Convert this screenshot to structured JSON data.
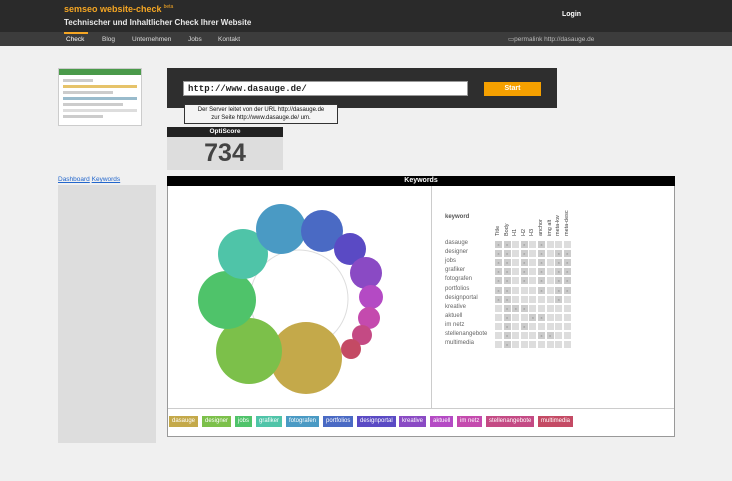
{
  "header": {
    "brand": "semseo website-check",
    "brand_sup": "beta",
    "tagline": "Technischer und Inhaltlicher Check Ihrer Website",
    "login": "Login"
  },
  "nav": {
    "items": [
      "Check",
      "Blog",
      "Unternehmen",
      "Jobs",
      "Kontakt"
    ],
    "permalink": "permalink http://dasauge.de"
  },
  "check": {
    "url_value": "http://www.dasauge.de/",
    "start_label": "Start",
    "tooltip_line1": "Der Server leitet von der URL http://dasauge.de",
    "tooltip_line2": "zur Seite http://www.dasauge.de/ um."
  },
  "score": {
    "label": "OptiScore",
    "value": "734"
  },
  "sidebar": {
    "links": [
      "Dashboard",
      "Keywords"
    ]
  },
  "keywords": {
    "title": "Keywords",
    "col_label": "keyword",
    "columns": [
      "Title",
      "Body",
      "H1",
      "H2",
      "H3",
      "anchor",
      "img alt",
      "meta-kw",
      "meta-desc"
    ],
    "rows": [
      {
        "name": "dasauge",
        "cells": [
          "x",
          "x",
          "",
          "x",
          "",
          "x",
          "",
          "",
          ""
        ]
      },
      {
        "name": "designer",
        "cells": [
          "x",
          "x",
          "",
          "x",
          "",
          "x",
          "",
          "x",
          "x"
        ]
      },
      {
        "name": "jobs",
        "cells": [
          "x",
          "x",
          "",
          "x",
          "",
          "x",
          "",
          "x",
          "x"
        ]
      },
      {
        "name": "grafiker",
        "cells": [
          "x",
          "x",
          "",
          "x",
          "",
          "x",
          "",
          "x",
          "x"
        ]
      },
      {
        "name": "fotografen",
        "cells": [
          "x",
          "x",
          "",
          "x",
          "",
          "x",
          "",
          "x",
          "x"
        ]
      },
      {
        "name": "portfolios",
        "cells": [
          "x",
          "x",
          "",
          "",
          "",
          "x",
          "",
          "x",
          "x"
        ]
      },
      {
        "name": "designportal",
        "cells": [
          "x",
          "x",
          "",
          "",
          "",
          "",
          "",
          "x",
          ""
        ]
      },
      {
        "name": "kreative",
        "cells": [
          "",
          "x",
          "x",
          "x",
          "",
          "",
          "",
          "",
          ""
        ]
      },
      {
        "name": "aktuell",
        "cells": [
          "",
          "x",
          "",
          "",
          "x",
          "x",
          "",
          "",
          ""
        ]
      },
      {
        "name": "im netz",
        "cells": [
          "",
          "x",
          "",
          "x",
          "",
          "",
          "",
          "",
          ""
        ]
      },
      {
        "name": "stellenangebote",
        "cells": [
          "",
          "x",
          "",
          "",
          "",
          "x",
          "x",
          "",
          ""
        ]
      },
      {
        "name": "multimedia",
        "cells": [
          "",
          "x",
          "",
          "",
          "",
          "",
          "",
          "",
          ""
        ]
      }
    ],
    "legend": [
      {
        "label": "dasauge",
        "color": "#c4a94a"
      },
      {
        "label": "designer",
        "color": "#7cc04a"
      },
      {
        "label": "jobs",
        "color": "#4fc36a"
      },
      {
        "label": "grafiker",
        "color": "#4fc4a8"
      },
      {
        "label": "fotografen",
        "color": "#4a9ac4"
      },
      {
        "label": "portfolios",
        "color": "#4a6ac4"
      },
      {
        "label": "designportal",
        "color": "#5a4ac4"
      },
      {
        "label": "kreative",
        "color": "#8a4ac4"
      },
      {
        "label": "aktuell",
        "color": "#b44ac4"
      },
      {
        "label": "im netz",
        "color": "#c44aae"
      },
      {
        "label": "stellenangebote",
        "color": "#c44a84"
      },
      {
        "label": "multimedia",
        "color": "#c44a64"
      }
    ]
  }
}
